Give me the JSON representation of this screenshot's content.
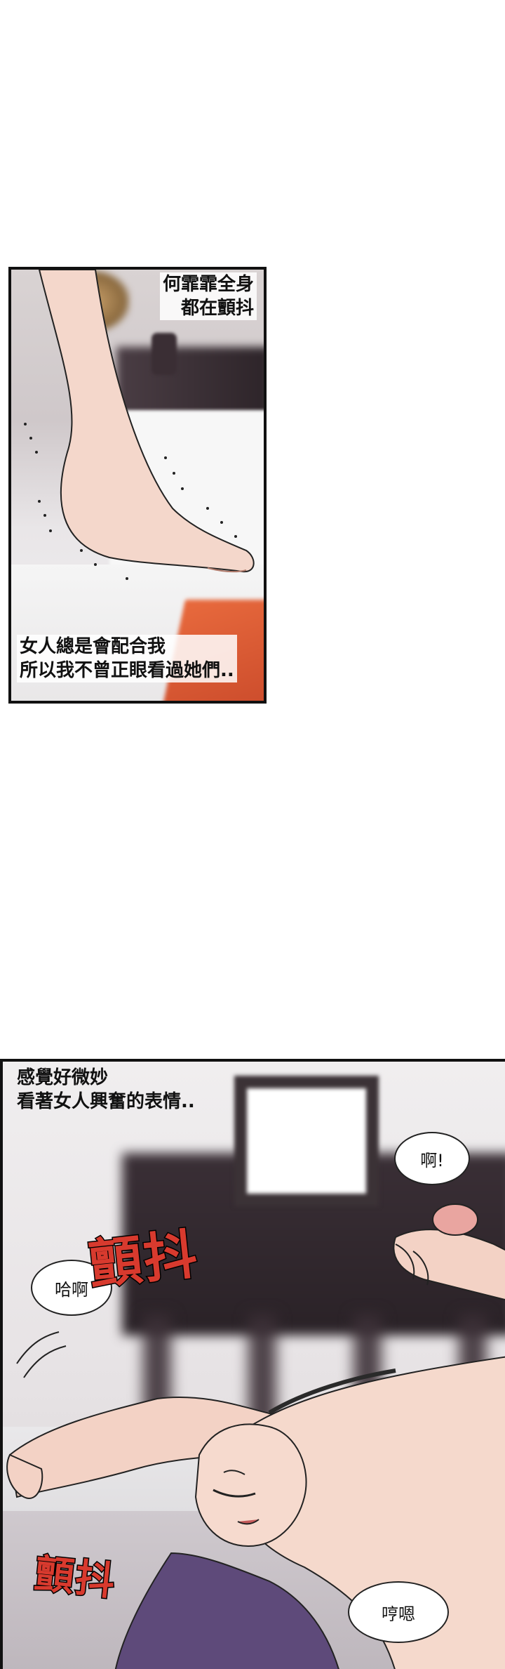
{
  "panel1": {
    "caption_top_line1": "何霏霏全身",
    "caption_top_line2": "都在顫抖",
    "caption_bottom_line1": "女人總是會配合我",
    "caption_bottom_line2": "所以我不曾正眼看過她們.."
  },
  "panel2": {
    "caption_line1": "感覺好微妙",
    "caption_line2": "看著女人興奮的表情..",
    "bubble_a": "啊!",
    "bubble_ha": "哈啊",
    "bubble_heng": "哼嗯",
    "sfx_1": "顫抖",
    "sfx_2": "顫抖"
  },
  "colors": {
    "sfx_red": "#d83a2e",
    "panel_border": "#111111"
  }
}
